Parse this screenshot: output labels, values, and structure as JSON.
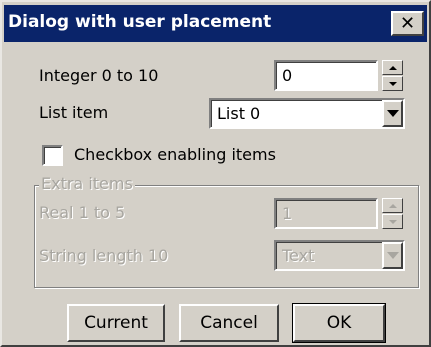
{
  "window": {
    "title": "Dialog with user placement",
    "close_glyph": "✕"
  },
  "integer_field": {
    "label": "Integer 0 to 10",
    "value": "0"
  },
  "list_field": {
    "label": "List item",
    "value": "List 0"
  },
  "checkbox": {
    "label": "Checkbox enabling items",
    "checked": false
  },
  "extra_group": {
    "legend": "Extra items",
    "real_field": {
      "label": "Real 1 to 5",
      "value": "1"
    },
    "string_field": {
      "label": "String length 10",
      "value": "Text"
    }
  },
  "buttons": {
    "current": "Current",
    "cancel": "Cancel",
    "ok": "OK"
  },
  "colors": {
    "title_bar": "#0a246a",
    "face": "#d4d0c8",
    "disabled_text": "#a8a6a0"
  }
}
